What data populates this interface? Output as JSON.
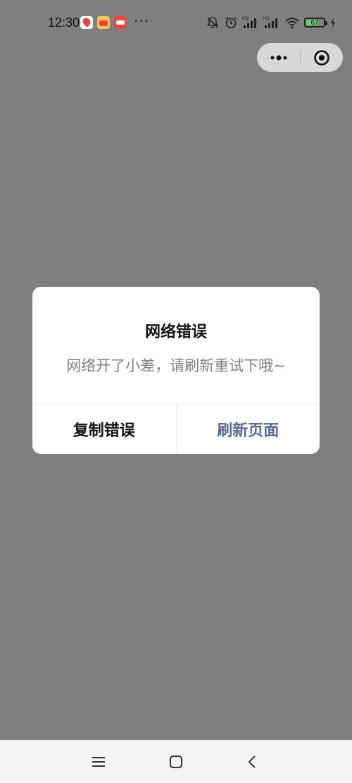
{
  "status_bar": {
    "time": "12:30",
    "more": "···",
    "battery_level": "67",
    "icons": [
      "map-app-icon",
      "shop-app-icon",
      "news-app-icon",
      "mute-icon",
      "alarm-icon",
      "signal-icon",
      "wifi-icon",
      "battery-icon",
      "charging-icon"
    ]
  },
  "capsule": {
    "menu_icon": "more-dots-icon",
    "close_icon": "close-miniprogram-icon"
  },
  "dialog": {
    "title": "网络错误",
    "message": "网络开了小差，请刷新重试下哦~",
    "copy_label": "复制错误",
    "refresh_label": "刷新页面",
    "refresh_color": "#576b95"
  },
  "nav_bar": {
    "icons": [
      "menu-icon",
      "home-icon",
      "back-icon"
    ]
  },
  "colors": {
    "overlay": "#7f7f7f",
    "dialog_bg": "#ffffff",
    "nav_bg": "#f4f4f4"
  }
}
